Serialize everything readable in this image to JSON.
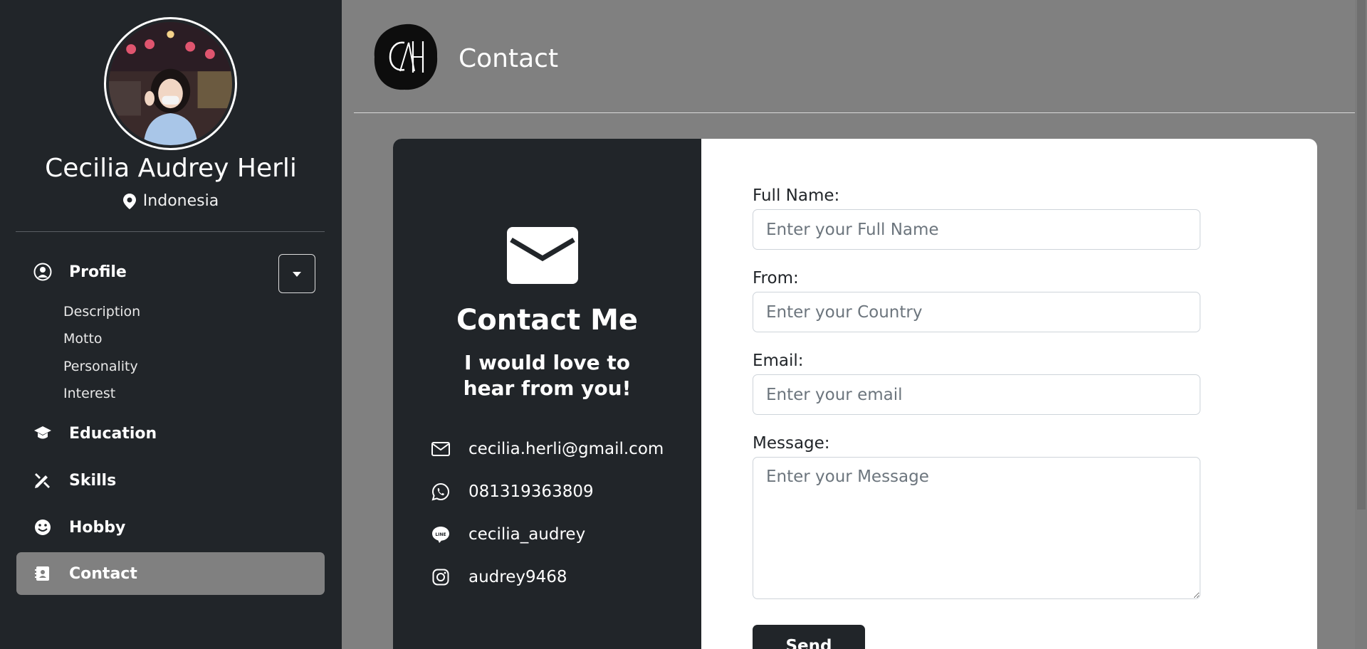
{
  "profile": {
    "name": "Cecilia Audrey Herli",
    "location": "Indonesia"
  },
  "nav": {
    "profile": "Profile",
    "profile_subitems": [
      "Description",
      "Motto",
      "Personality",
      "Interest"
    ],
    "education": "Education",
    "skills": "Skills",
    "hobby": "Hobby",
    "contact": "Contact"
  },
  "header": {
    "title": "Contact"
  },
  "contact_card": {
    "title": "Contact Me",
    "subtitle": "I would love to hear from you!",
    "email": "cecilia.herli@gmail.com",
    "phone": "081319363809",
    "line": "cecilia_audrey",
    "instagram": "audrey9468"
  },
  "form": {
    "full_name_label": "Full Name:",
    "full_name_placeholder": "Enter your Full Name",
    "from_label": "From:",
    "from_placeholder": "Enter your Country",
    "email_label": "Email:",
    "email_placeholder": "Enter your email",
    "message_label": "Message:",
    "message_placeholder": "Enter your Message",
    "send_label": "Send"
  },
  "colors": {
    "sidebar_bg": "#212529",
    "page_bg": "#808080",
    "active_nav": "#808080"
  }
}
